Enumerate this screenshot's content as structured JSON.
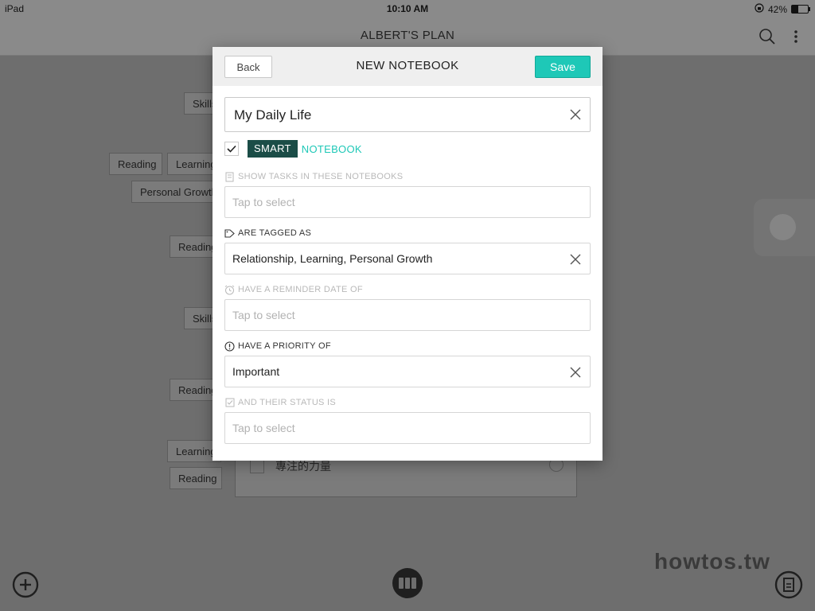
{
  "statusbar": {
    "device": "iPad",
    "time": "10:10 AM",
    "battery": "42%",
    "battery_level": 0.42
  },
  "header": {
    "title": "ALBERT'S PLAN",
    "search_icon": "search-icon",
    "menu_icon": "more-vertical-icon"
  },
  "background": {
    "tags": [
      {
        "label": "Skills"
      },
      {
        "label": "Reading"
      },
      {
        "label": "Learning"
      },
      {
        "label": "Personal Growth"
      },
      {
        "label": "Reading"
      },
      {
        "label": "Skills"
      },
      {
        "label": "Reading"
      },
      {
        "label": "Learning"
      },
      {
        "label": "Reading"
      }
    ],
    "task_text": "專注的力量",
    "watermark": "howtos.tw"
  },
  "modal": {
    "back_label": "Back",
    "title": "NEW NOTEBOOK",
    "save_label": "Save",
    "name_value": "My Daily Life",
    "smart_label": "SMART",
    "notebook_label": "NOTEBOOK",
    "smart_checked": true,
    "sections": {
      "notebooks": {
        "label": "SHOW TASKS IN THESE NOTEBOOKS",
        "placeholder": "Tap to select"
      },
      "tags": {
        "label": "ARE TAGGED AS",
        "value": "Relationship, Learning, Personal Growth"
      },
      "reminder": {
        "label": "HAVE A REMINDER DATE OF",
        "placeholder": "Tap to select"
      },
      "priority": {
        "label": "HAVE A PRIORITY OF",
        "value": "Important"
      },
      "status": {
        "label": "AND THEIR STATUS IS",
        "placeholder": "Tap to select"
      }
    }
  },
  "colors": {
    "accent": "#1ec8b7",
    "smart_bg": "#1b4d47",
    "overlay": "#6e6e6e"
  }
}
